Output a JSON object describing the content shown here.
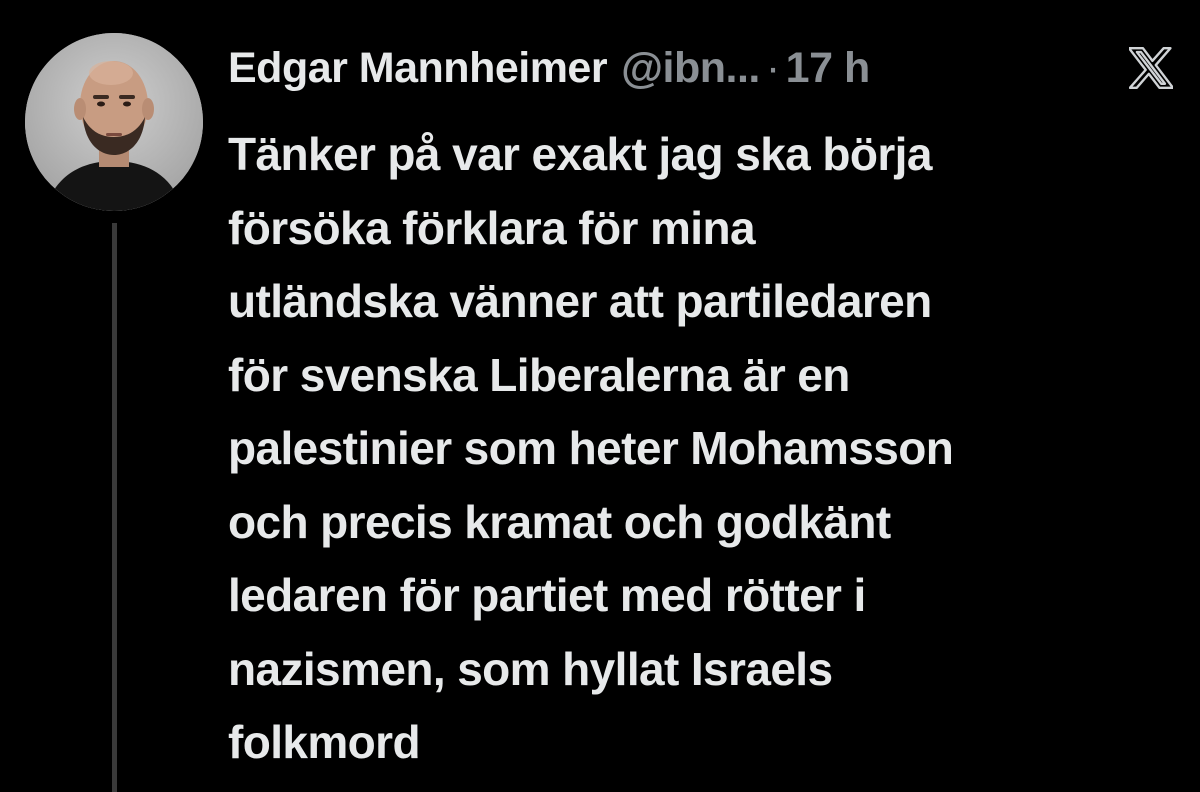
{
  "tweet": {
    "author": {
      "display_name": "Edgar Mannheimer",
      "handle": "@ibn...",
      "avatar_icon": "profile-photo"
    },
    "separator": "·",
    "timestamp": "17 h",
    "platform_icon": "x-logo-icon",
    "text_lines": [
      "Tänker på var exakt jag ska börja",
      "försöka förklara för mina",
      "utländska vänner att partiledaren",
      "för svenska Liberalerna är en",
      "palestinier som heter Mohamsson",
      "och precis kramat och godkänt",
      "ledaren för partiet med rötter i",
      "nazismen, som hyllat Israels",
      "folkmord"
    ]
  },
  "colors": {
    "background": "#000000",
    "text_primary": "#e7e9ea",
    "text_secondary": "#8a8f94",
    "thread_line": "#3a3a3a"
  }
}
